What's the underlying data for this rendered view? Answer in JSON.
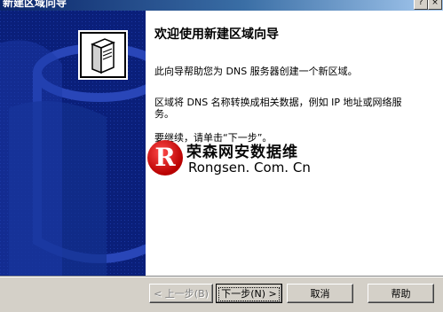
{
  "window": {
    "title": "新建区域向导"
  },
  "content": {
    "heading": "欢迎使用新建区域向导",
    "para1": "此向导帮助您为 DNS 服务器创建一个新区域。",
    "para2": "区域将 DNS 名称转换成相关数据，例如 IP 地址或网络服务。",
    "para3": "要继续，请单击“下一步”。"
  },
  "watermark": {
    "logo_letter": "R",
    "text_cn": "荣森网安数据维",
    "text_en": "Rongsen. Com. Cn"
  },
  "buttons": {
    "back": "< 上一步(B)",
    "next": "下一步(N) >",
    "cancel": "取消",
    "help": "帮助"
  },
  "colors": {
    "side_panel": "#0a1f7a",
    "content_bg": "#ffffff",
    "dialog_bg": "#d4d0c8",
    "watermark_red": "#cc0000"
  }
}
